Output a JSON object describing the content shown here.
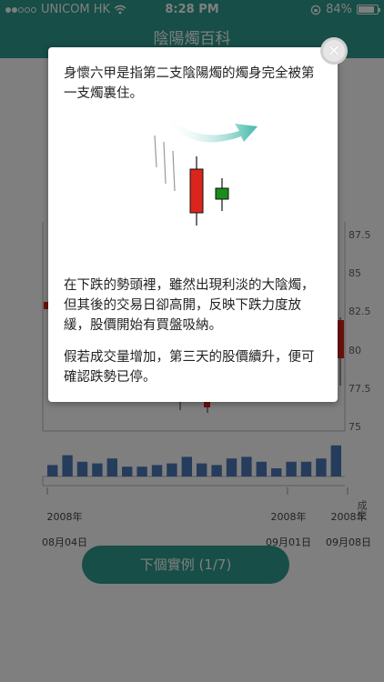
{
  "status_bar": {
    "carrier": "UNICOM HK",
    "time": "8:28 PM",
    "battery": "84%",
    "icons": [
      "signal-dots-icon",
      "wifi-icon",
      "rotation-lock-icon",
      "battery-icon"
    ]
  },
  "header": {
    "title": "陰陽燭百科"
  },
  "chart": {
    "y_ticks": [
      "87.5",
      "85",
      "82.5",
      "80",
      "77.5",
      "75"
    ],
    "volume_label": "成交",
    "x_labels": [
      {
        "line1": "2008年",
        "line2": "08月04日"
      },
      {
        "line1": "2008年",
        "line2": "09月01日"
      },
      {
        "line1": "2008年",
        "line2": "09月08日"
      }
    ],
    "volume_fractions": [
      0.35,
      0.65,
      0.45,
      0.4,
      0.55,
      0.3,
      0.3,
      0.35,
      0.4,
      0.6,
      0.4,
      0.35,
      0.55,
      0.6,
      0.45,
      0.25,
      0.45,
      0.45,
      0.55,
      0.95
    ]
  },
  "modal": {
    "intro": "身懷六甲是指第二支陰陽燭的燭身完全被第一支燭裏住。",
    "paragraph1": "在下跌的勢頭裡，雖然出現利淡的大陰燭，但其後的交易日卻高開，反映下跌力度放緩，股價開始有買盤吸納。",
    "paragraph2": "假若成交量增加，第三天的股價續升，便可確認跌勢已停。",
    "close_icon": "close-icon"
  },
  "next_button": {
    "label": "下個實例 (1/7)"
  },
  "colors": {
    "teal": "#2e9c8e",
    "bearish": "#d9251c",
    "bullish": "#1a8c1a",
    "volume": "#4d79b8"
  }
}
